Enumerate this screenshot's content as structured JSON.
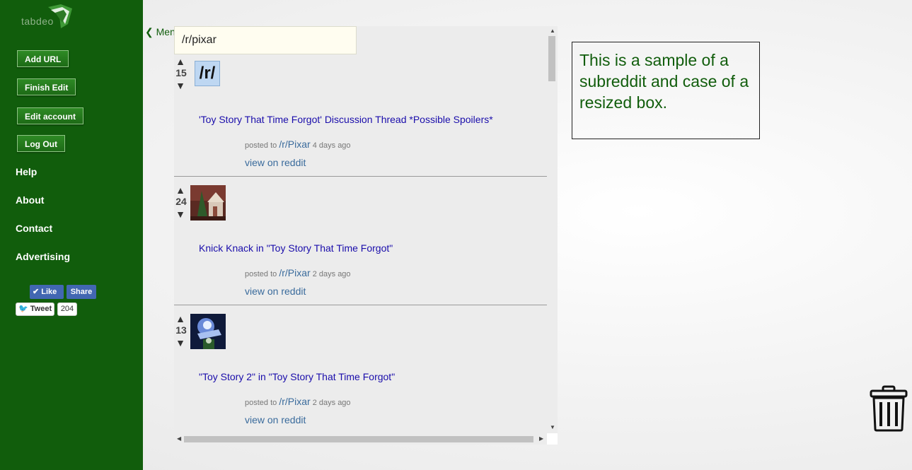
{
  "logo": {
    "text": "tabdeo"
  },
  "sidebar": {
    "buttons": [
      "Add URL",
      "Finish Edit",
      "Edit account",
      "Log Out"
    ],
    "links": [
      "Help",
      "About",
      "Contact",
      "Advertising"
    ],
    "social": {
      "like": "Like",
      "share": "Share",
      "tweet": "Tweet",
      "tweet_count": "204"
    }
  },
  "menu_toggle": "❮ Menu",
  "widget": {
    "input_value": "/r/pixar",
    "posts": [
      {
        "score": "15",
        "thumb": "/r/",
        "title": "'Toy Story That Time Forgot' Discussion Thread *Possible Spoilers*",
        "posted_prefix": "posted to ",
        "subreddit": "/r/Pixar",
        "age": " 4 days ago",
        "view": "view on reddit"
      },
      {
        "score": "24",
        "title": "Knick Knack in \"Toy Story That Time Forgot\"",
        "posted_prefix": "posted to ",
        "subreddit": "/r/Pixar",
        "age": " 2 days ago",
        "view": "view on reddit"
      },
      {
        "score": "13",
        "title": "\"Toy Story 2\" in \"Toy Story That Time Forgot\"",
        "posted_prefix": "posted to ",
        "subreddit": "/r/Pixar",
        "age": " 2 days ago",
        "view": "view on reddit"
      }
    ],
    "vote_up": "▲",
    "vote_down": "▼"
  },
  "note_text": "This is a sample of a subreddit and case of a resized box.",
  "icons": {
    "trash": "trash-icon"
  },
  "colors": {
    "sidebar": "#115d0c",
    "note_text": "#115d0c",
    "link": "#1a0dab"
  }
}
